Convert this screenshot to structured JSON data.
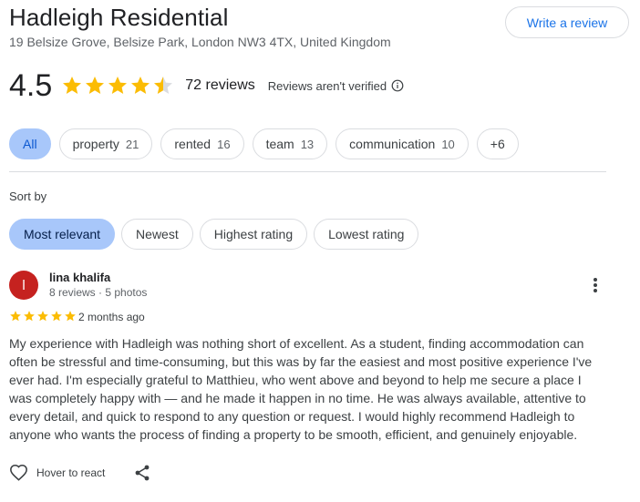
{
  "place": {
    "name": "Hadleigh Residential",
    "address": "19 Belsize Grove, Belsize Park, London NW3 4TX, United Kingdom"
  },
  "write_review_label": "Write a review",
  "summary": {
    "rating": "4.5",
    "rating_value": 4.5,
    "reviews_count": "72 reviews",
    "verified_note": "Reviews aren't verified",
    "star_color": "#fbbc04"
  },
  "topics": [
    {
      "label": "All",
      "count": ""
    },
    {
      "label": "property",
      "count": "21"
    },
    {
      "label": "rented",
      "count": "16"
    },
    {
      "label": "team",
      "count": "13"
    },
    {
      "label": "communication",
      "count": "10"
    },
    {
      "label": "+6",
      "count": ""
    }
  ],
  "sort": {
    "label": "Sort by",
    "options": [
      "Most relevant",
      "Newest",
      "Highest rating",
      "Lowest rating"
    ],
    "selected": "Most relevant"
  },
  "review": {
    "avatar_letter": "l",
    "avatar_color": "#c5221f",
    "name": "lina khalifa",
    "meta": "8 reviews · 5 photos",
    "stars": 5,
    "time": "2 months ago",
    "text": "My experience with Hadleigh was nothing short of excellent. As a student, finding accommodation can often be stressful and time-consuming, but this was by far the easiest and most positive experience I've ever had. I'm especially grateful to Matthieu, who went above and beyond to help me secure a place I was completely happy with — and he made it happen in no time. He was always available, attentive to every detail, and quick to respond to any question or request. I would highly recommend Hadleigh to anyone who wants the process of finding a property to be smooth, efficient, and genuinely enjoyable.",
    "react_label": "Hover to react"
  },
  "icons": {
    "info": "info-icon",
    "more": "more-vert-icon",
    "react": "heart-outline-icon",
    "share": "share-icon"
  }
}
